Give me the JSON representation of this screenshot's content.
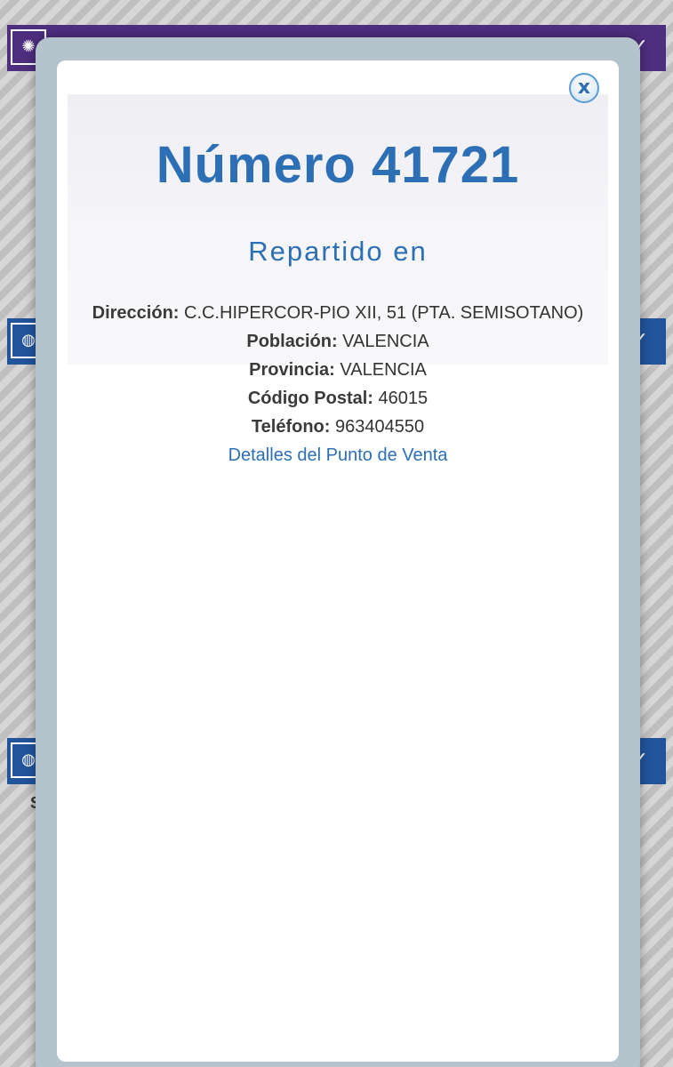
{
  "background": {
    "icon_names": [
      "starburst-icon",
      "globe-icon",
      "globe-icon"
    ],
    "chevron_icon": "chevron-down-icon",
    "partial_letter": "S"
  },
  "modal": {
    "close_label": "x",
    "title": "Número 41721",
    "subtitle": "Repartido en",
    "fields": [
      {
        "label": "Dirección:",
        "value": "C.C.HIPERCOR-PIO XII, 51 (PTA. SEMISOTANO)"
      },
      {
        "label": "Población:",
        "value": "VALENCIA"
      },
      {
        "label": "Provincia:",
        "value": "VALENCIA"
      },
      {
        "label": "Código Postal:",
        "value": "46015"
      },
      {
        "label": "Teléfono:",
        "value": "963404550"
      }
    ],
    "detail_link": "Detalles del Punto de Venta"
  },
  "colors": {
    "accent_blue": "#2c6fb5",
    "header_purple": "#4e2e7f",
    "header_blue": "#21549a",
    "modal_frame": "#b5c4cc"
  }
}
